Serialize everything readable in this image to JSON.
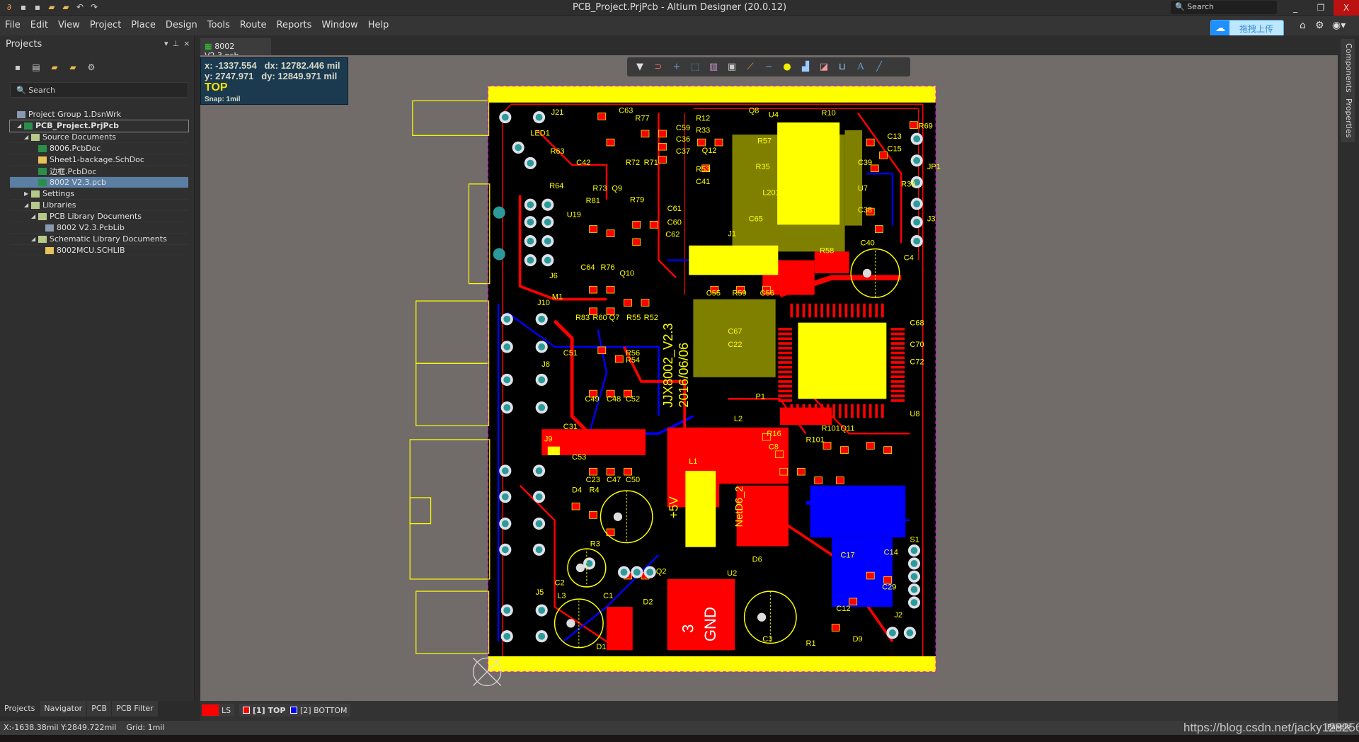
{
  "titlebar": {
    "title": "PCB_Project.PrjPcb - Altium Designer (20.0.12)",
    "search_placeholder": "Search",
    "minimize": "_",
    "restore": "❐",
    "close": "X"
  },
  "menu": [
    "File",
    "Edit",
    "View",
    "Project",
    "Place",
    "Design",
    "Tools",
    "Route",
    "Reports",
    "Window",
    "Help"
  ],
  "upload": {
    "label": "拖拽上传",
    "icon": "cloud-icon"
  },
  "colors": {
    "accent": "#1e90ff",
    "top_layer": "#ff0000",
    "bottom_layer": "#0000ff",
    "silkscreen": "#ffff00",
    "board": "#000000",
    "canvas": "#716b6a"
  },
  "projects_panel": {
    "title": "Projects",
    "search_placeholder": "Search",
    "tree": [
      {
        "label": "Project Group 1.DsnWrk",
        "level": 0,
        "icon": "workspace"
      },
      {
        "label": "PCB_Project.PrjPcb",
        "level": 1,
        "icon": "pcb",
        "bold": true,
        "expanded": true
      },
      {
        "label": "Source Documents",
        "level": 2,
        "icon": "folder",
        "expanded": true
      },
      {
        "label": "8006.PcbDoc",
        "level": 3,
        "icon": "pcb"
      },
      {
        "label": "Sheet1-backage.SchDoc",
        "level": 3,
        "icon": "sch"
      },
      {
        "label": "边框.PcbDoc",
        "level": 3,
        "icon": "pcb"
      },
      {
        "label": "8002 V2.3.pcb",
        "level": 3,
        "icon": "pcb",
        "selected": true
      },
      {
        "label": "Settings",
        "level": 2,
        "icon": "folder",
        "expanded": false
      },
      {
        "label": "Libraries",
        "level": 2,
        "icon": "folder",
        "expanded": true
      },
      {
        "label": "PCB Library Documents",
        "level": 3,
        "icon": "folder",
        "expanded": true
      },
      {
        "label": "8002 V2.3.PcbLib",
        "level": 4,
        "icon": "lib"
      },
      {
        "label": "Schematic Library Documents",
        "level": 3,
        "icon": "folder",
        "expanded": true
      },
      {
        "label": "8002MCU.SCHLIB",
        "level": 4,
        "icon": "schlib"
      }
    ],
    "bottom_tabs": [
      "Projects",
      "Navigator",
      "PCB",
      "PCB Filter"
    ]
  },
  "document_tab": "8002 V2.3.pcb",
  "coord_overlay": {
    "x": "x: -1337.554",
    "dx": "dx: 12782.446 mil",
    "y": "y:  2747.971",
    "dy": "dy: 12849.971 mil",
    "layer": "TOP",
    "snap": "Snap: 1mil"
  },
  "right_panels": [
    "Components",
    "Properties"
  ],
  "layers": [
    {
      "label": "LS",
      "color": "#ff0000"
    },
    {
      "label": "[1] TOP",
      "color": "#ff0000"
    },
    {
      "label": "[2] BOTTOM",
      "color": "#0000ff"
    }
  ],
  "status": {
    "coords": "X:-1638.38mil Y:2849.722mil",
    "grid": "Grid: 1mil"
  },
  "watermark": "https://blog.csdn.net/jacky128256",
  "panels_button": "Panels",
  "pcb": {
    "board_text": [
      "JJX8002_V2.3",
      "2016/06/06",
      "+5V",
      "NetD6_2",
      "3",
      "GND"
    ],
    "labels": [
      "J21",
      "C63",
      "R77",
      "R12",
      "Q8",
      "U4",
      "R10",
      "R69",
      "LED1",
      "C42",
      "R72",
      "R71",
      "C59",
      "C36",
      "C37",
      "R33",
      "Q12",
      "R53",
      "C41",
      "C13",
      "C15",
      "R63",
      "R64",
      "R73",
      "Q9",
      "R81",
      "R79",
      "C61",
      "C60",
      "C62",
      "U19",
      "J1",
      "C65",
      "R58",
      "C4",
      "J6",
      "C64",
      "R76",
      "Q10",
      "C55",
      "R59",
      "C56",
      "J10",
      "M1",
      "R83",
      "R60",
      "Q7",
      "R55",
      "R52",
      "J8",
      "C49",
      "C48",
      "C52",
      "P1",
      "L2",
      "R16",
      "C8",
      "R101",
      "Q11",
      "J9",
      "C23",
      "C47",
      "C50",
      "L1",
      "D4",
      "R4",
      "D6",
      "U2",
      "L3",
      "C1",
      "D2",
      "Q2",
      "J5",
      "D1",
      "C3",
      "R1",
      "D9",
      "J2",
      "S1",
      "C12",
      "C29",
      "C14",
      "C17",
      "C2",
      "R3",
      "U7",
      "JP1",
      "J3",
      "R39",
      "C39",
      "C38",
      "C40",
      "R35",
      "L201",
      "R57",
      "U8",
      "C72",
      "C70",
      "C68",
      "C67",
      "C22",
      "R101",
      "R56",
      "R54",
      "C51",
      "C53",
      "C31"
    ]
  }
}
